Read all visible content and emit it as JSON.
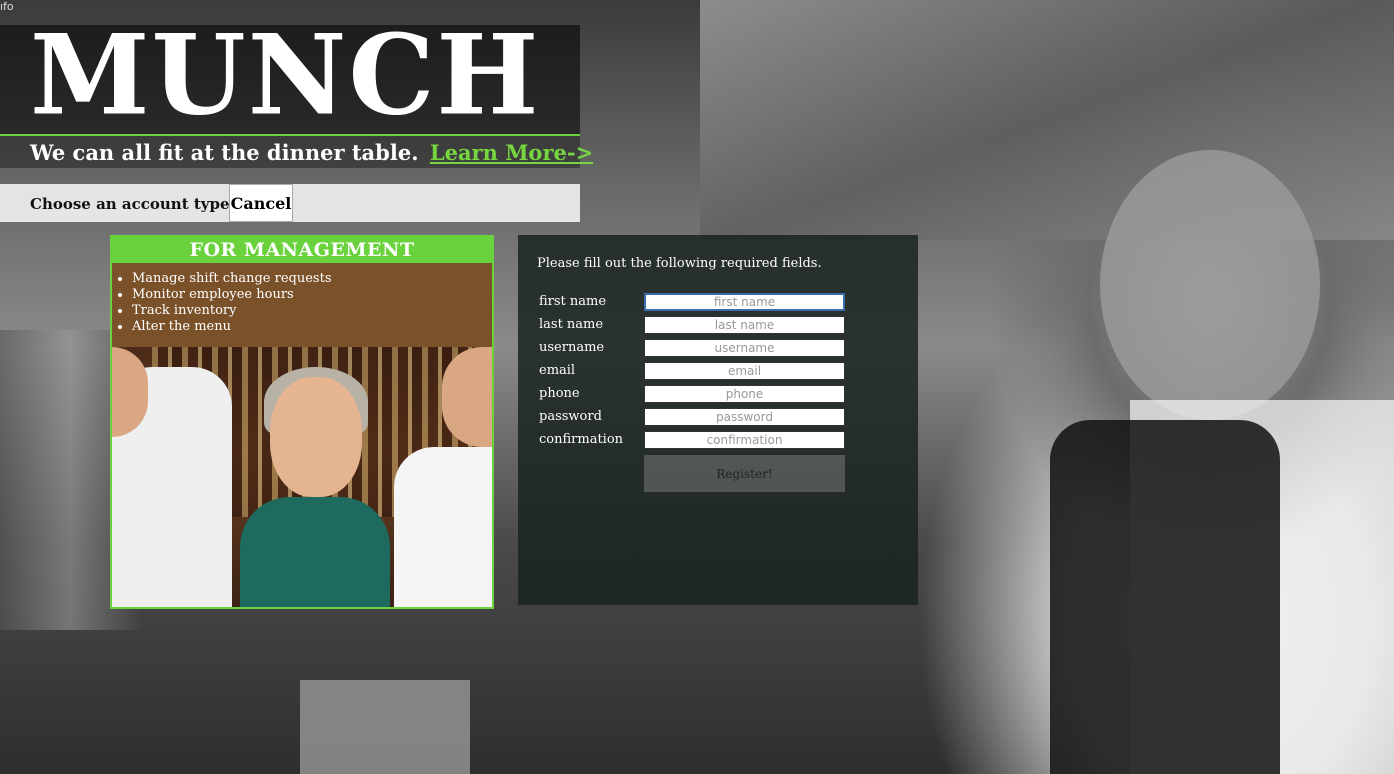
{
  "top_left_fragment": "ıfo",
  "brand": {
    "title": "MUNCH",
    "tagline": "We can all fit at the dinner table.",
    "learn_more": "Learn More->",
    "accent_color": "#6ad23c"
  },
  "account": {
    "label": "Choose an account type:",
    "cancel": "Cancel"
  },
  "management_card": {
    "title": "FOR MANAGEMENT",
    "features": [
      "Manage shift change requests",
      "Monitor employee hours",
      "Track inventory",
      "Alter the menu"
    ]
  },
  "form": {
    "intro": "Please fill out the following required fields.",
    "fields": [
      {
        "label": "first name",
        "placeholder": "first name"
      },
      {
        "label": "last name",
        "placeholder": "last name"
      },
      {
        "label": "username",
        "placeholder": "username"
      },
      {
        "label": "email",
        "placeholder": "email"
      },
      {
        "label": "phone",
        "placeholder": "phone"
      },
      {
        "label": "password",
        "placeholder": "password"
      },
      {
        "label": "confirmation",
        "placeholder": "confirmation"
      }
    ],
    "submit": "Register!"
  }
}
